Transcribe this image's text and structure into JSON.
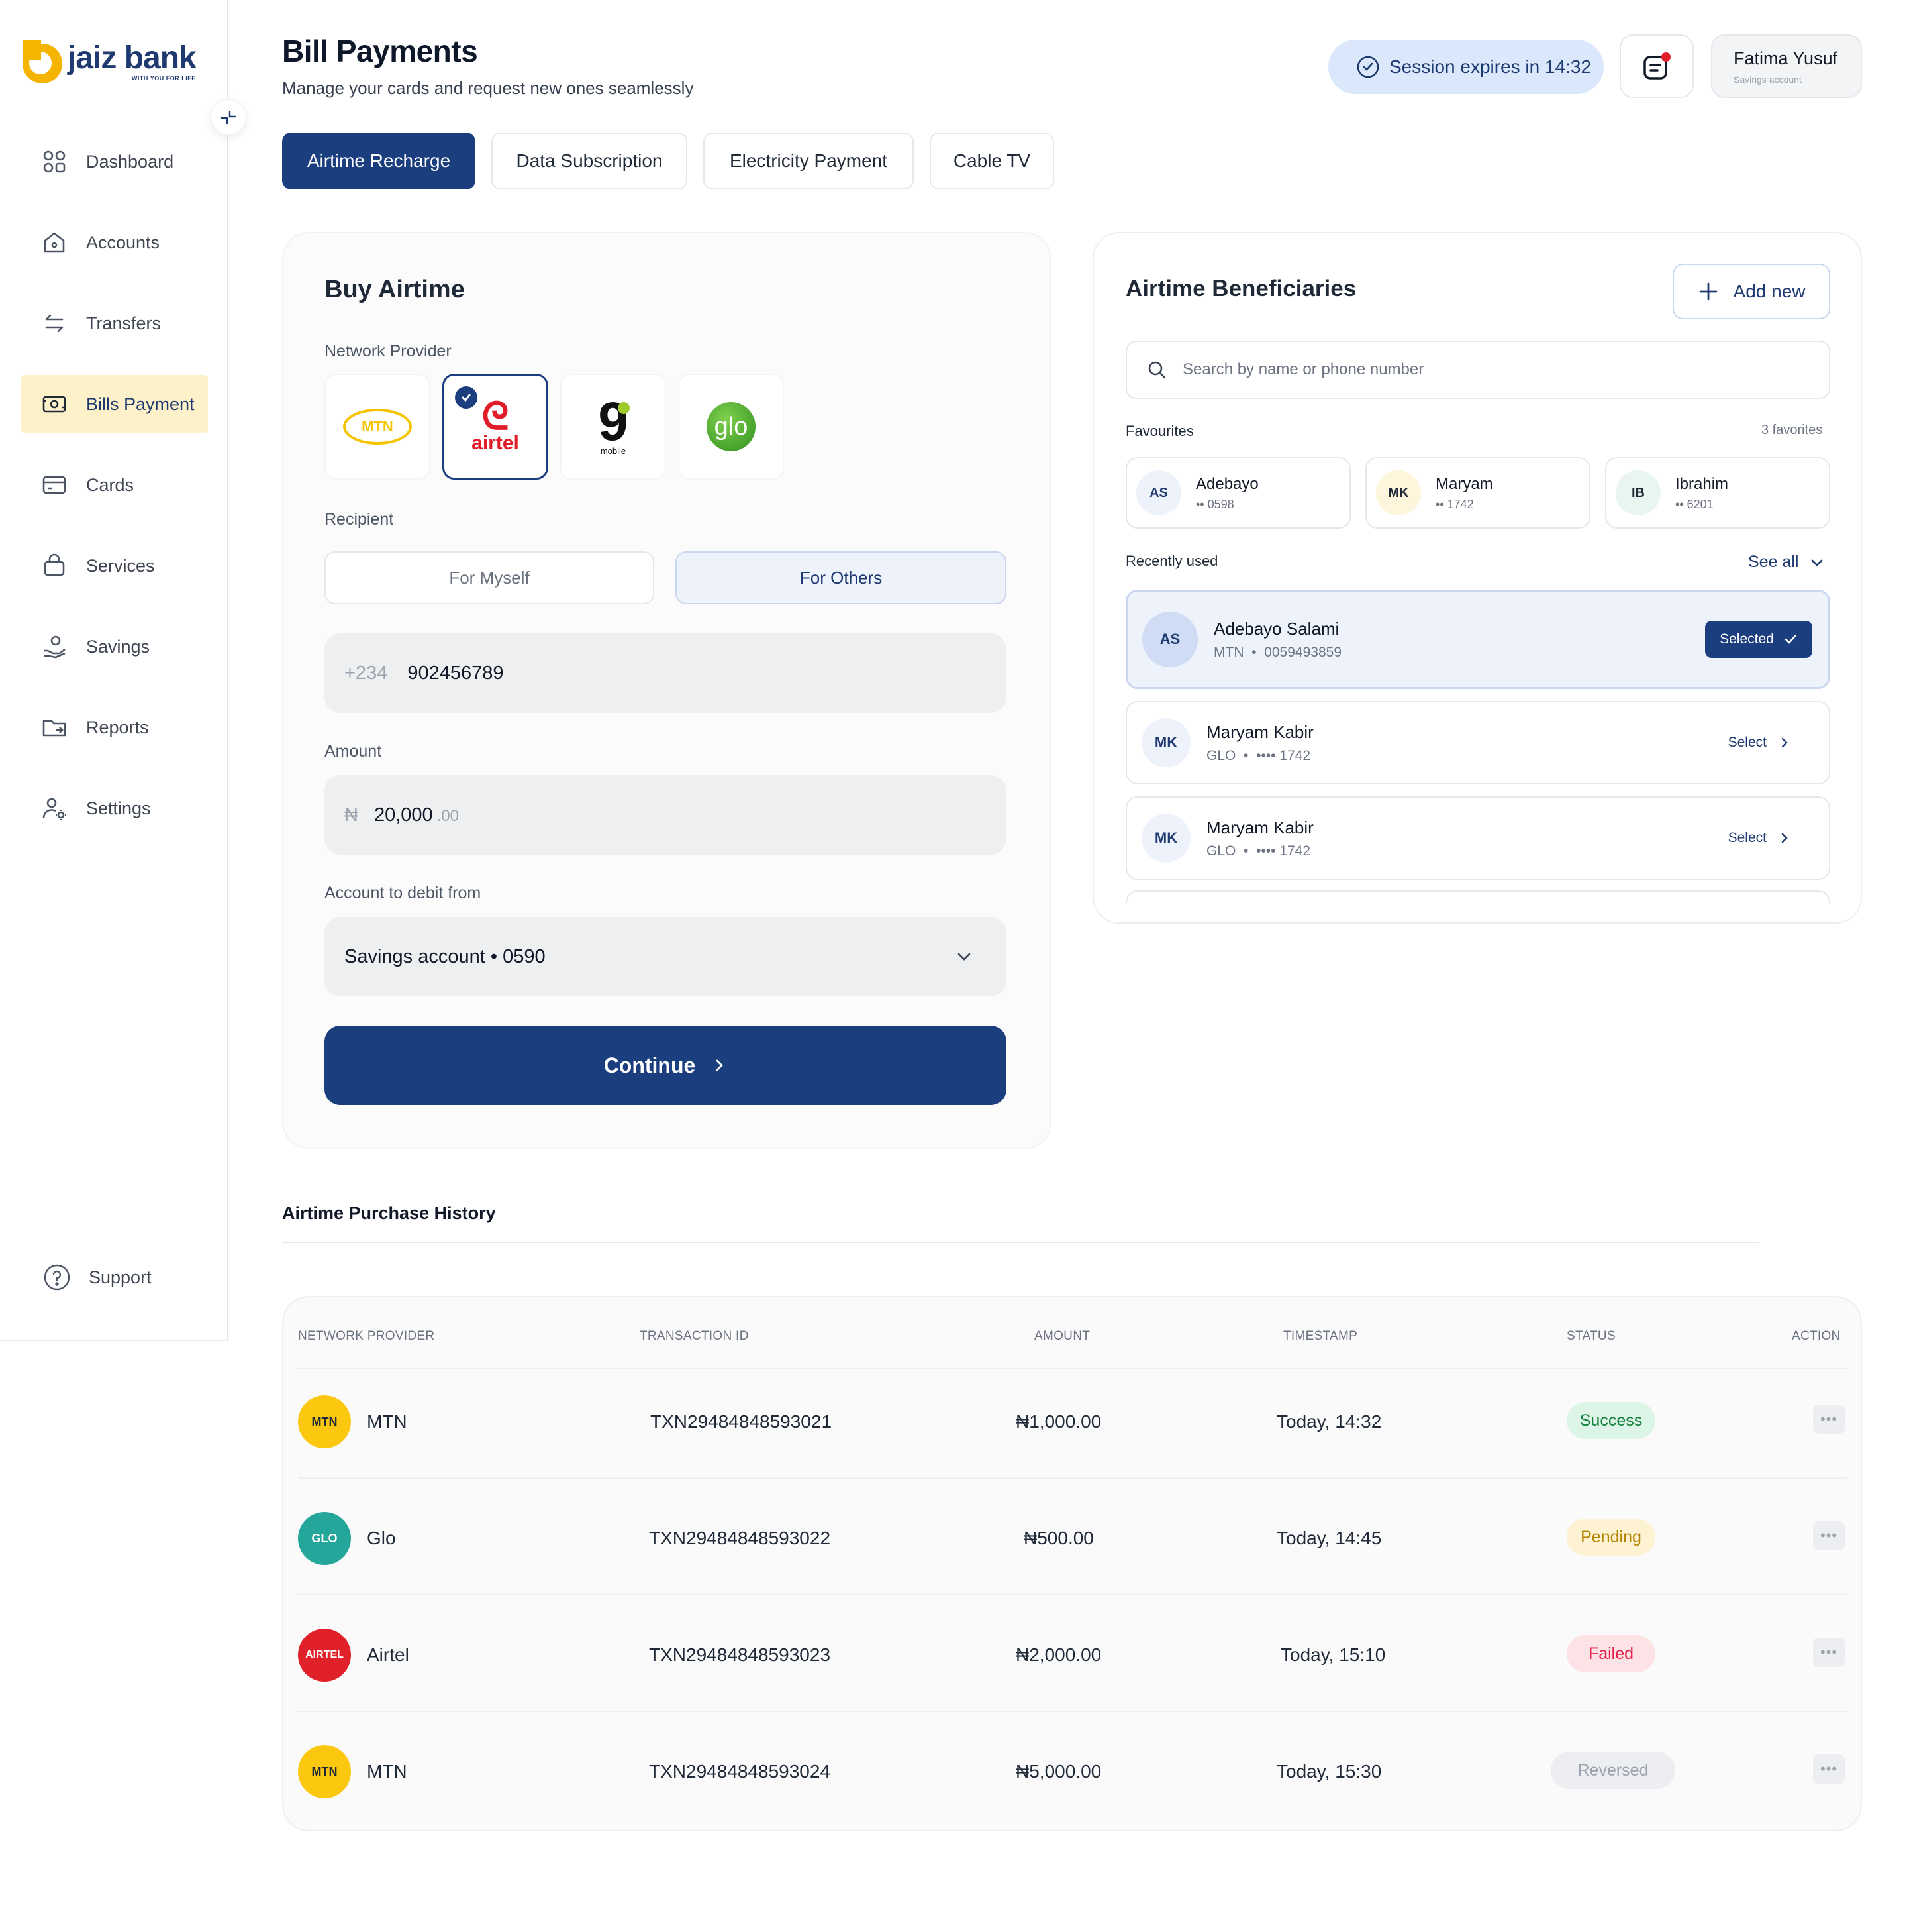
{
  "brand": {
    "name": "jaiz bank",
    "tagline": "WITH YOU FOR LIFE"
  },
  "sidebar": {
    "items": [
      {
        "label": "Dashboard",
        "icon": "dashboard-icon"
      },
      {
        "label": "Accounts",
        "icon": "home-icon"
      },
      {
        "label": "Transfers",
        "icon": "transfer-icon"
      },
      {
        "label": "Bills Payment",
        "icon": "bill-icon",
        "active": true
      },
      {
        "label": "Cards",
        "icon": "card-icon"
      },
      {
        "label": "Services",
        "icon": "bag-icon"
      },
      {
        "label": "Savings",
        "icon": "savings-icon"
      },
      {
        "label": "Reports",
        "icon": "folder-icon"
      },
      {
        "label": "Settings",
        "icon": "user-settings-icon"
      }
    ],
    "support": "Support"
  },
  "header": {
    "title": "Bill Payments",
    "subtitle": "Manage your cards and request new ones seamlessly",
    "session": "Session expires in 14:32",
    "user": {
      "name": "Fatima Yusuf",
      "account": "Savings account"
    }
  },
  "tabs": [
    {
      "label": "Airtime Recharge",
      "active": true
    },
    {
      "label": "Data Subscription"
    },
    {
      "label": "Electricity Payment"
    },
    {
      "label": "Cable TV"
    }
  ],
  "buy": {
    "title": "Buy Airtime",
    "network_label": "Network Provider",
    "providers": [
      {
        "name": "MTN",
        "logo_text": "MTN"
      },
      {
        "name": "Airtel",
        "logo_text": "airtel",
        "selected": true
      },
      {
        "name": "9mobile",
        "logo_text": "9",
        "logo_sub": "mobile"
      },
      {
        "name": "Glo",
        "logo_text": "glo"
      }
    ],
    "recipient_label": "Recipient",
    "recipient_options": [
      "For Myself",
      "For Others"
    ],
    "recipient_selected": "For Others",
    "phone_prefix": "+234",
    "phone_value": "902456789",
    "amount_label": "Amount",
    "currency_symbol": "₦",
    "amount_value": "20,000",
    "amount_cents": ".00",
    "debit_label": "Account to debit from",
    "debit_value": "Savings account • 0590",
    "continue_label": "Continue"
  },
  "beneficiaries": {
    "title": "Airtime Beneficiaries",
    "add_label": "Add new",
    "search_placeholder": "Search by name or phone number",
    "favourites_label": "Favourites",
    "favourites_count": "3 favorites",
    "favourites": [
      {
        "initials": "AS",
        "name": "Adebayo",
        "number": "•• 0598"
      },
      {
        "initials": "MK",
        "name": "Maryam",
        "number": "•• 1742"
      },
      {
        "initials": "IB",
        "name": "Ibrahim",
        "number": "•• 6201"
      }
    ],
    "recent_label": "Recently used",
    "see_all": "See all",
    "recent": [
      {
        "initials": "AS",
        "name": "Adebayo Salami",
        "network": "MTN",
        "number": "0059493859",
        "action": "Selected"
      },
      {
        "initials": "MK",
        "name": "Maryam Kabir",
        "network": "GLO",
        "number": "•••• 1742",
        "action": "Select"
      },
      {
        "initials": "MK",
        "name": "Maryam Kabir",
        "network": "GLO",
        "number": "•••• 1742",
        "action": "Select"
      }
    ]
  },
  "history": {
    "title": "Airtime Purchase History",
    "columns": [
      "NETWORK PROVIDER",
      "TRANSACTION ID",
      "AMOUNT",
      "TIMESTAMP",
      "STATUS",
      "ACTION"
    ],
    "rows": [
      {
        "badge": "MTN",
        "provider": "MTN",
        "txn": "TXN29484848593021",
        "amount": "₦1,000.00",
        "time": "Today, 14:32",
        "status": "Success"
      },
      {
        "badge": "GLO",
        "provider": "Glo",
        "txn": "TXN29484848593022",
        "amount": "₦500.00",
        "time": "Today, 14:45",
        "status": "Pending"
      },
      {
        "badge": "AIRTEL",
        "provider": "Airtel",
        "txn": "TXN29484848593023",
        "amount": "₦2,000.00",
        "time": "Today, 15:10",
        "status": "Failed"
      },
      {
        "badge": "MTN",
        "provider": "MTN",
        "txn": "TXN29484848593024",
        "amount": "₦5,000.00",
        "time": "Today, 15:30",
        "status": "Reversed"
      }
    ]
  },
  "colors": {
    "primary": "#1b3e7e",
    "accent": "#f5b400",
    "active_nav_bg": "#fdf1c9",
    "success": "#16a34a",
    "pending": "#d9a400",
    "failed": "#e11d48",
    "reversed": "#9ca3af"
  }
}
